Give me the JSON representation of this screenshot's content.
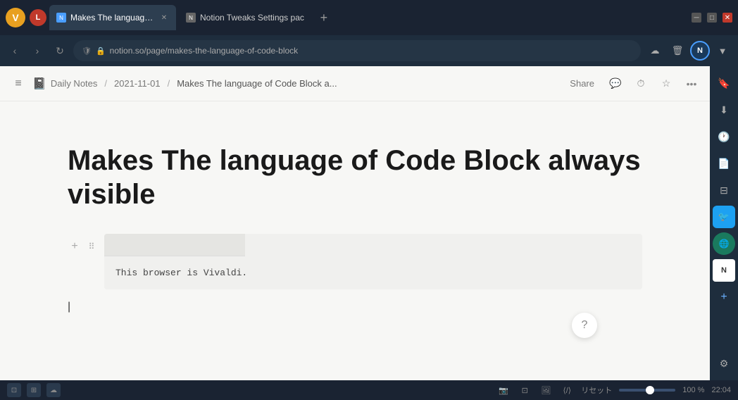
{
  "titlebar": {
    "app_icon": "V",
    "profile_icon": "L",
    "tabs": [
      {
        "label": "Makes The language of Co...",
        "favicon": "N",
        "active": true
      },
      {
        "label": "Notion Tweaks Settings pac",
        "favicon": "N",
        "active": false
      }
    ],
    "new_tab_label": "+"
  },
  "navbar": {
    "back_label": "‹",
    "forward_label": "›",
    "reload_label": "↻",
    "address": "notion.so/page/makes-the-language-of-code-block",
    "shield_icon": "🛡",
    "lock_icon": "🔒",
    "profile_label": "N",
    "extensions_label": "▼"
  },
  "notion": {
    "topbar": {
      "menu_label": "≡",
      "page_icon": "📓",
      "breadcrumb_root": "Daily Notes",
      "breadcrumb_date": "2021-11-01",
      "breadcrumb_current": "Makes The language of Code Block a...",
      "share_label": "Share",
      "comment_icon": "💬",
      "history_icon": "⏱",
      "favorite_icon": "☆",
      "more_icon": "···"
    },
    "page": {
      "title": "Makes The language of Code Block always visible",
      "code_block": {
        "language": "",
        "content": "This browser is Vivaldi."
      },
      "cursor_visible": true,
      "help_btn_label": "?"
    }
  },
  "right_sidebar": {
    "icons": [
      {
        "name": "bookmark-icon",
        "symbol": "🔖"
      },
      {
        "name": "download-icon",
        "symbol": "⬇"
      },
      {
        "name": "history-sidebar-icon",
        "symbol": "🕐"
      },
      {
        "name": "reader-icon",
        "symbol": "📄"
      },
      {
        "name": "panels-icon",
        "symbol": "⊟"
      },
      {
        "name": "twitter-icon",
        "symbol": "🐦"
      },
      {
        "name": "web-icon",
        "symbol": "🌐"
      },
      {
        "name": "notion-icon",
        "symbol": "N"
      },
      {
        "name": "add-panel-icon",
        "symbol": "+"
      },
      {
        "name": "settings-icon",
        "symbol": "⚙"
      }
    ]
  },
  "statusbar": {
    "left_icons": [
      "⊡",
      "⊞",
      "☁"
    ],
    "right": {
      "camera_icon": "📷",
      "window_icon": "⊡",
      "image_icon": "🖼",
      "code_icon": "⟨/⟩",
      "reset_label": "リセット",
      "zoom_percent": "100 %",
      "time": "22:04"
    }
  }
}
